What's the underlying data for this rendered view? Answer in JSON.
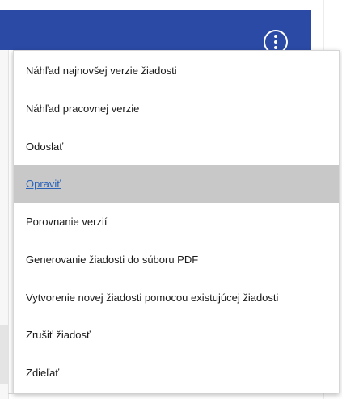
{
  "header": {
    "more_actions_icon": "kebab-vertical-icon",
    "bar_color": "#2b4aa6"
  },
  "menu": {
    "items": [
      {
        "label": "Náhľad najnovšej verzie žiadosti"
      },
      {
        "label": "Náhľad pracovnej verzie"
      },
      {
        "label": "Odoslať"
      },
      {
        "label": "Opraviť",
        "state": "hovered"
      },
      {
        "label": "Porovnanie verzií"
      },
      {
        "label": "Generovanie žiadosti do súboru PDF"
      },
      {
        "label": "Vytvorenie novej žiadosti pomocou existujúcej žiadosti"
      },
      {
        "label": "Zrušiť žiadosť"
      },
      {
        "label": "Zdieľať"
      }
    ],
    "hover_background": "#c8c8c8",
    "hover_link_color": "#2a63b8"
  }
}
